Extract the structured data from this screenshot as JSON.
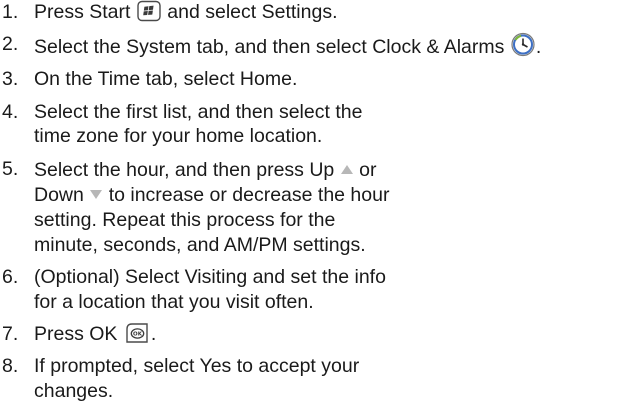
{
  "steps": [
    {
      "number": "1.",
      "lines": [
        [
          "Press Start",
          "and select Settings."
        ]
      ],
      "icon": "start-button-icon"
    },
    {
      "number": "2.",
      "lines": [
        [
          "Select the System tab, and then select Clock & Alarms",
          "."
        ]
      ],
      "icon": "clock-alarms-icon"
    },
    {
      "number": "3.",
      "lines": [
        [
          "On the Time tab, select Home."
        ]
      ]
    },
    {
      "number": "4.",
      "lines": [
        [
          "Select the first list, and then select the"
        ],
        [
          "time zone for your home location."
        ]
      ]
    },
    {
      "number": "5.",
      "lines": [
        [
          "Select the hour, and then press Up",
          "or"
        ],
        [
          "Down",
          "to increase or decrease the hour"
        ],
        [
          "setting. Repeat this process for the"
        ],
        [
          "minute, seconds, and AM/PM settings."
        ]
      ],
      "icons": [
        "up-arrow-icon",
        "down-arrow-icon"
      ]
    },
    {
      "number": "6.",
      "lines": [
        [
          "(Optional) Select Visiting and set the info"
        ],
        [
          "for a location that you visit often."
        ]
      ]
    },
    {
      "number": "7.",
      "lines": [
        [
          "Press OK",
          "."
        ]
      ],
      "icon": "ok-button-icon"
    },
    {
      "number": "8.",
      "lines": [
        [
          "If prompted, select Yes to accept your"
        ],
        [
          "changes."
        ]
      ]
    }
  ],
  "colors": {
    "text": "#1a1a1a",
    "arrow": "#b7b7b7",
    "clock_blue": "#3d6fc4",
    "clock_green": "#7fb83a"
  }
}
